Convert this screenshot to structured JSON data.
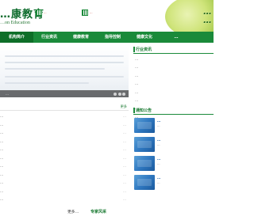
{
  "header": {
    "logo_text": "…康教育",
    "logo_sub": "…on Education",
    "hotline_1": "…",
    "hotline_2": "…",
    "banner_text_1": "…",
    "banner_text_2": "…"
  },
  "nav": {
    "items": [
      "机构简介",
      "行业资讯",
      "健康教育",
      "指导控制",
      "健康文化",
      "…"
    ]
  },
  "slider": {
    "caption": "…"
  },
  "industry_news": {
    "title": "行业资讯",
    "items": [
      "…",
      "…",
      "…",
      "…",
      "…",
      "…",
      "…",
      "…"
    ]
  },
  "left_list": {
    "more_label": "更多",
    "items": [
      {
        "title": "…",
        "date": "…"
      },
      {
        "title": "…",
        "date": "…"
      },
      {
        "title": "…",
        "date": "…"
      },
      {
        "title": "…",
        "date": "…"
      },
      {
        "title": "…",
        "date": "…"
      },
      {
        "title": "…",
        "date": "…"
      },
      {
        "title": "…",
        "date": "…"
      },
      {
        "title": "…",
        "date": "…"
      },
      {
        "title": "…",
        "date": "…"
      },
      {
        "title": "…",
        "date": "…"
      },
      {
        "title": "…",
        "date": "…"
      }
    ]
  },
  "announcements": {
    "title": "通知公告",
    "items": [
      {
        "title": "…",
        "desc": "…"
      },
      {
        "title": "…",
        "desc": "…"
      },
      {
        "title": "…",
        "desc": "…"
      },
      {
        "title": "…",
        "desc": "…"
      }
    ]
  },
  "bottom": {
    "pager": "更多…",
    "section_title": "专家风采"
  },
  "colors": {
    "primary_green": "#1a8a3a",
    "dark_green": "#0e6e28",
    "title_green": "#1a7a32",
    "link_blue": "#1a5ea8",
    "hotline_red": "#c0392b"
  },
  "icons": {
    "hotline_1": "qr-code-icon",
    "hotline_2": "qr-code-icon"
  }
}
